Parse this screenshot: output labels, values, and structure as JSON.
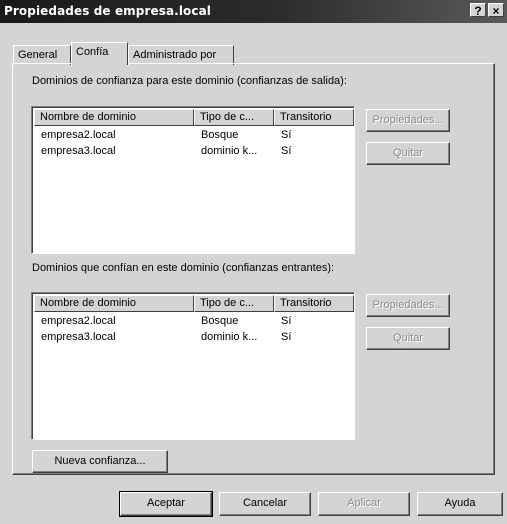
{
  "window": {
    "title": "Propiedades de empresa.local",
    "help_button": "?",
    "close_button": "×"
  },
  "tabs": [
    {
      "label": "General"
    },
    {
      "label": "Confía"
    },
    {
      "label": "Administrado por"
    }
  ],
  "outgoing": {
    "label": "Dominios de confianza para este dominio (confianzas de salida):",
    "columns": [
      "Nombre de dominio",
      "Tipo de c...",
      "Transitorio"
    ],
    "rows": [
      [
        "empresa2.local",
        "Bosque",
        "Sí"
      ],
      [
        "empresa3.local",
        "dominio k...",
        "Sí"
      ]
    ],
    "properties_button": "Propiedades...",
    "remove_button": "Quitar"
  },
  "incoming": {
    "label": "Dominios que confían en este dominio (confianzas entrantes):",
    "columns": [
      "Nombre de dominio",
      "Tipo de c...",
      "Transitorio"
    ],
    "rows": [
      [
        "empresa2.local",
        "Bosque",
        "Sí"
      ],
      [
        "empresa3.local",
        "dominio k...",
        "Sí"
      ]
    ],
    "properties_button": "Propiedades...",
    "remove_button": "Quitar"
  },
  "new_trust_button": "Nueva confianza...",
  "footer": {
    "accept": "Aceptar",
    "cancel": "Cancelar",
    "apply": "Aplicar",
    "help": "Ayuda"
  }
}
